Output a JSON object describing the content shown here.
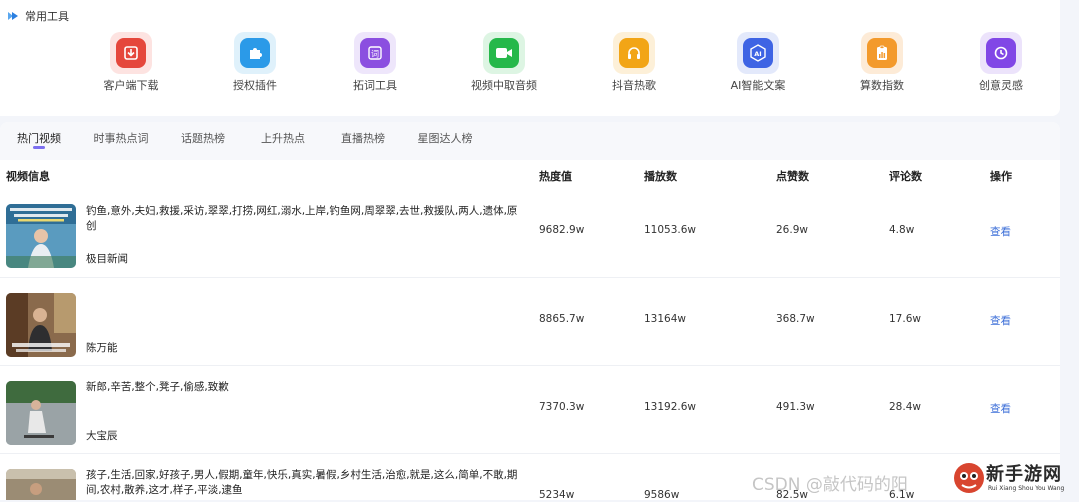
{
  "tools_section": {
    "title": "常用工具",
    "items": [
      {
        "label": "客户端下载",
        "icon": "download-icon",
        "bg": "#fde3e1",
        "fg": "#e5473c"
      },
      {
        "label": "授权插件",
        "icon": "puzzle-icon",
        "bg": "#dff1fb",
        "fg": "#2b9ae8"
      },
      {
        "label": "拓词工具",
        "icon": "word-icon",
        "bg": "#eee6fb",
        "fg": "#8b4fe0"
      },
      {
        "label": "视频中取音频",
        "icon": "video-camera-icon",
        "bg": "#ddf5e3",
        "fg": "#25b84a"
      },
      {
        "label": "抖音热歌",
        "icon": "headphones-icon",
        "bg": "#fdf0d8",
        "fg": "#f2a516"
      },
      {
        "label": "AI智能文案",
        "icon": "ai-icon",
        "bg": "#e3e9fb",
        "fg": "#3e64e4"
      },
      {
        "label": "算数指数",
        "icon": "clipboard-chart-icon",
        "bg": "#fdebd7",
        "fg": "#f39a2c"
      },
      {
        "label": "创意灵感",
        "icon": "lightbulb-icon",
        "bg": "#ece3fb",
        "fg": "#8147e6"
      }
    ]
  },
  "tabs": [
    {
      "label": "热门视频",
      "active": true
    },
    {
      "label": "时事热点词",
      "active": false
    },
    {
      "label": "话题热榜",
      "active": false
    },
    {
      "label": "上升热点",
      "active": false
    },
    {
      "label": "直播热榜",
      "active": false
    },
    {
      "label": "星图达人榜",
      "active": false
    }
  ],
  "table": {
    "headers": {
      "video_info": "视频信息",
      "heat": "热度值",
      "plays": "播放数",
      "likes": "点赞数",
      "comments": "评论数",
      "action": "操作"
    },
    "rows": [
      {
        "desc": "钓鱼,意外,夫妇,救援,采访,翠翠,打捞,网红,溺水,上岸,钓鱼网,周翠翠,去世,救援队,两人,遗体,原创",
        "author": "极目新闻",
        "heat": "9682.9w",
        "plays": "11053.6w",
        "likes": "26.9w",
        "comments": "4.8w",
        "action": "查看"
      },
      {
        "desc": "",
        "author": "陈万能",
        "heat": "8865.7w",
        "plays": "13164w",
        "likes": "368.7w",
        "comments": "17.6w",
        "action": "查看"
      },
      {
        "desc": "新郎,辛苦,整个,凳子,偷感,致歉",
        "author": "大宝辰",
        "heat": "7370.3w",
        "plays": "13192.6w",
        "likes": "491.3w",
        "comments": "28.4w",
        "action": "查看"
      },
      {
        "desc": "孩子,生活,回家,好孩子,男人,假期,童年,快乐,真实,暑假,乡村生活,治愈,就是,这么,简单,不敢,期间,农村,散养,这才,样子,平淡,逮鱼",
        "author": "",
        "heat": "5234w",
        "plays": "9586w",
        "likes": "82.5w",
        "comments": "6.1w",
        "action": ""
      }
    ]
  },
  "watermark": "CSDN @敲代码的阳",
  "brand_logo": {
    "text": "新手游网",
    "sub": "Rui Xiang Shou You Wang"
  }
}
